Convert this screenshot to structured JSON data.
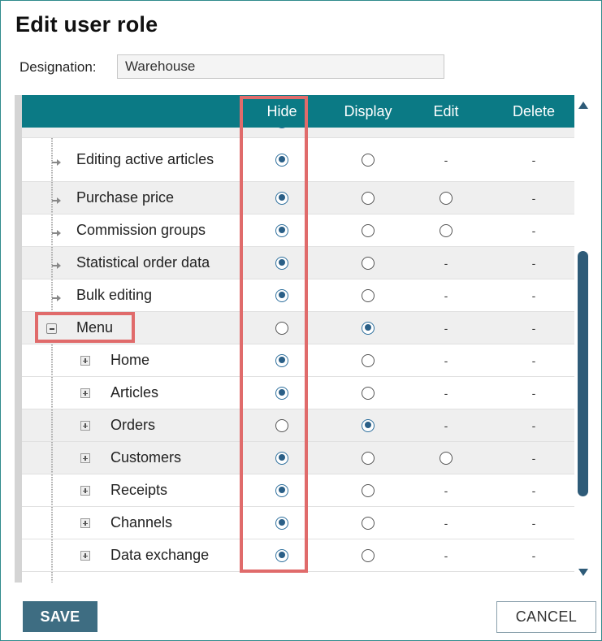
{
  "dialog": {
    "title": "Edit user role",
    "designation_label": "Designation:",
    "designation_value": "Warehouse"
  },
  "columns": [
    "Hide",
    "Display",
    "Edit",
    "Delete"
  ],
  "rows": [
    {
      "label": "Editing active articles",
      "level": 2,
      "type": "leaf",
      "hide": true,
      "display": false,
      "edit": "-",
      "delete": "-"
    },
    {
      "label": "Purchase price",
      "level": 2,
      "type": "leaf",
      "hide": true,
      "display": false,
      "edit": "radio",
      "delete": "-"
    },
    {
      "label": "Commission groups",
      "level": 2,
      "type": "leaf",
      "hide": true,
      "display": false,
      "edit": "radio",
      "delete": "-"
    },
    {
      "label": "Statistical order data",
      "level": 2,
      "type": "leaf",
      "hide": true,
      "display": false,
      "edit": "-",
      "delete": "-"
    },
    {
      "label": "Bulk editing",
      "level": 2,
      "type": "leaf",
      "hide": true,
      "display": false,
      "edit": "-",
      "delete": "-"
    },
    {
      "label": "Menu",
      "level": 1,
      "type": "expanded",
      "hide": false,
      "display": true,
      "edit": "-",
      "delete": "-"
    },
    {
      "label": "Home",
      "level": 2,
      "type": "collapsed",
      "hide": true,
      "display": false,
      "edit": "-",
      "delete": "-"
    },
    {
      "label": "Articles",
      "level": 2,
      "type": "collapsed",
      "hide": true,
      "display": false,
      "edit": "-",
      "delete": "-"
    },
    {
      "label": "Orders",
      "level": 2,
      "type": "collapsed",
      "hide": false,
      "display": true,
      "edit": "-",
      "delete": "-"
    },
    {
      "label": "Customers",
      "level": 2,
      "type": "collapsed",
      "hide": true,
      "display": false,
      "edit": "radio",
      "delete": "-"
    },
    {
      "label": "Receipts",
      "level": 2,
      "type": "collapsed",
      "hide": true,
      "display": false,
      "edit": "-",
      "delete": "-"
    },
    {
      "label": "Channels",
      "level": 2,
      "type": "collapsed",
      "hide": true,
      "display": false,
      "edit": "-",
      "delete": "-"
    },
    {
      "label": "Data exchange",
      "level": 2,
      "type": "collapsed",
      "hide": true,
      "display": false,
      "edit": "-",
      "delete": "-"
    }
  ],
  "buttons": {
    "save": "SAVE",
    "cancel": "CANCEL"
  },
  "colors": {
    "header": "#0b7a85",
    "highlight": "#e06b6b",
    "save_button": "#3e6d82",
    "radio_selected": "#2a5f87"
  }
}
